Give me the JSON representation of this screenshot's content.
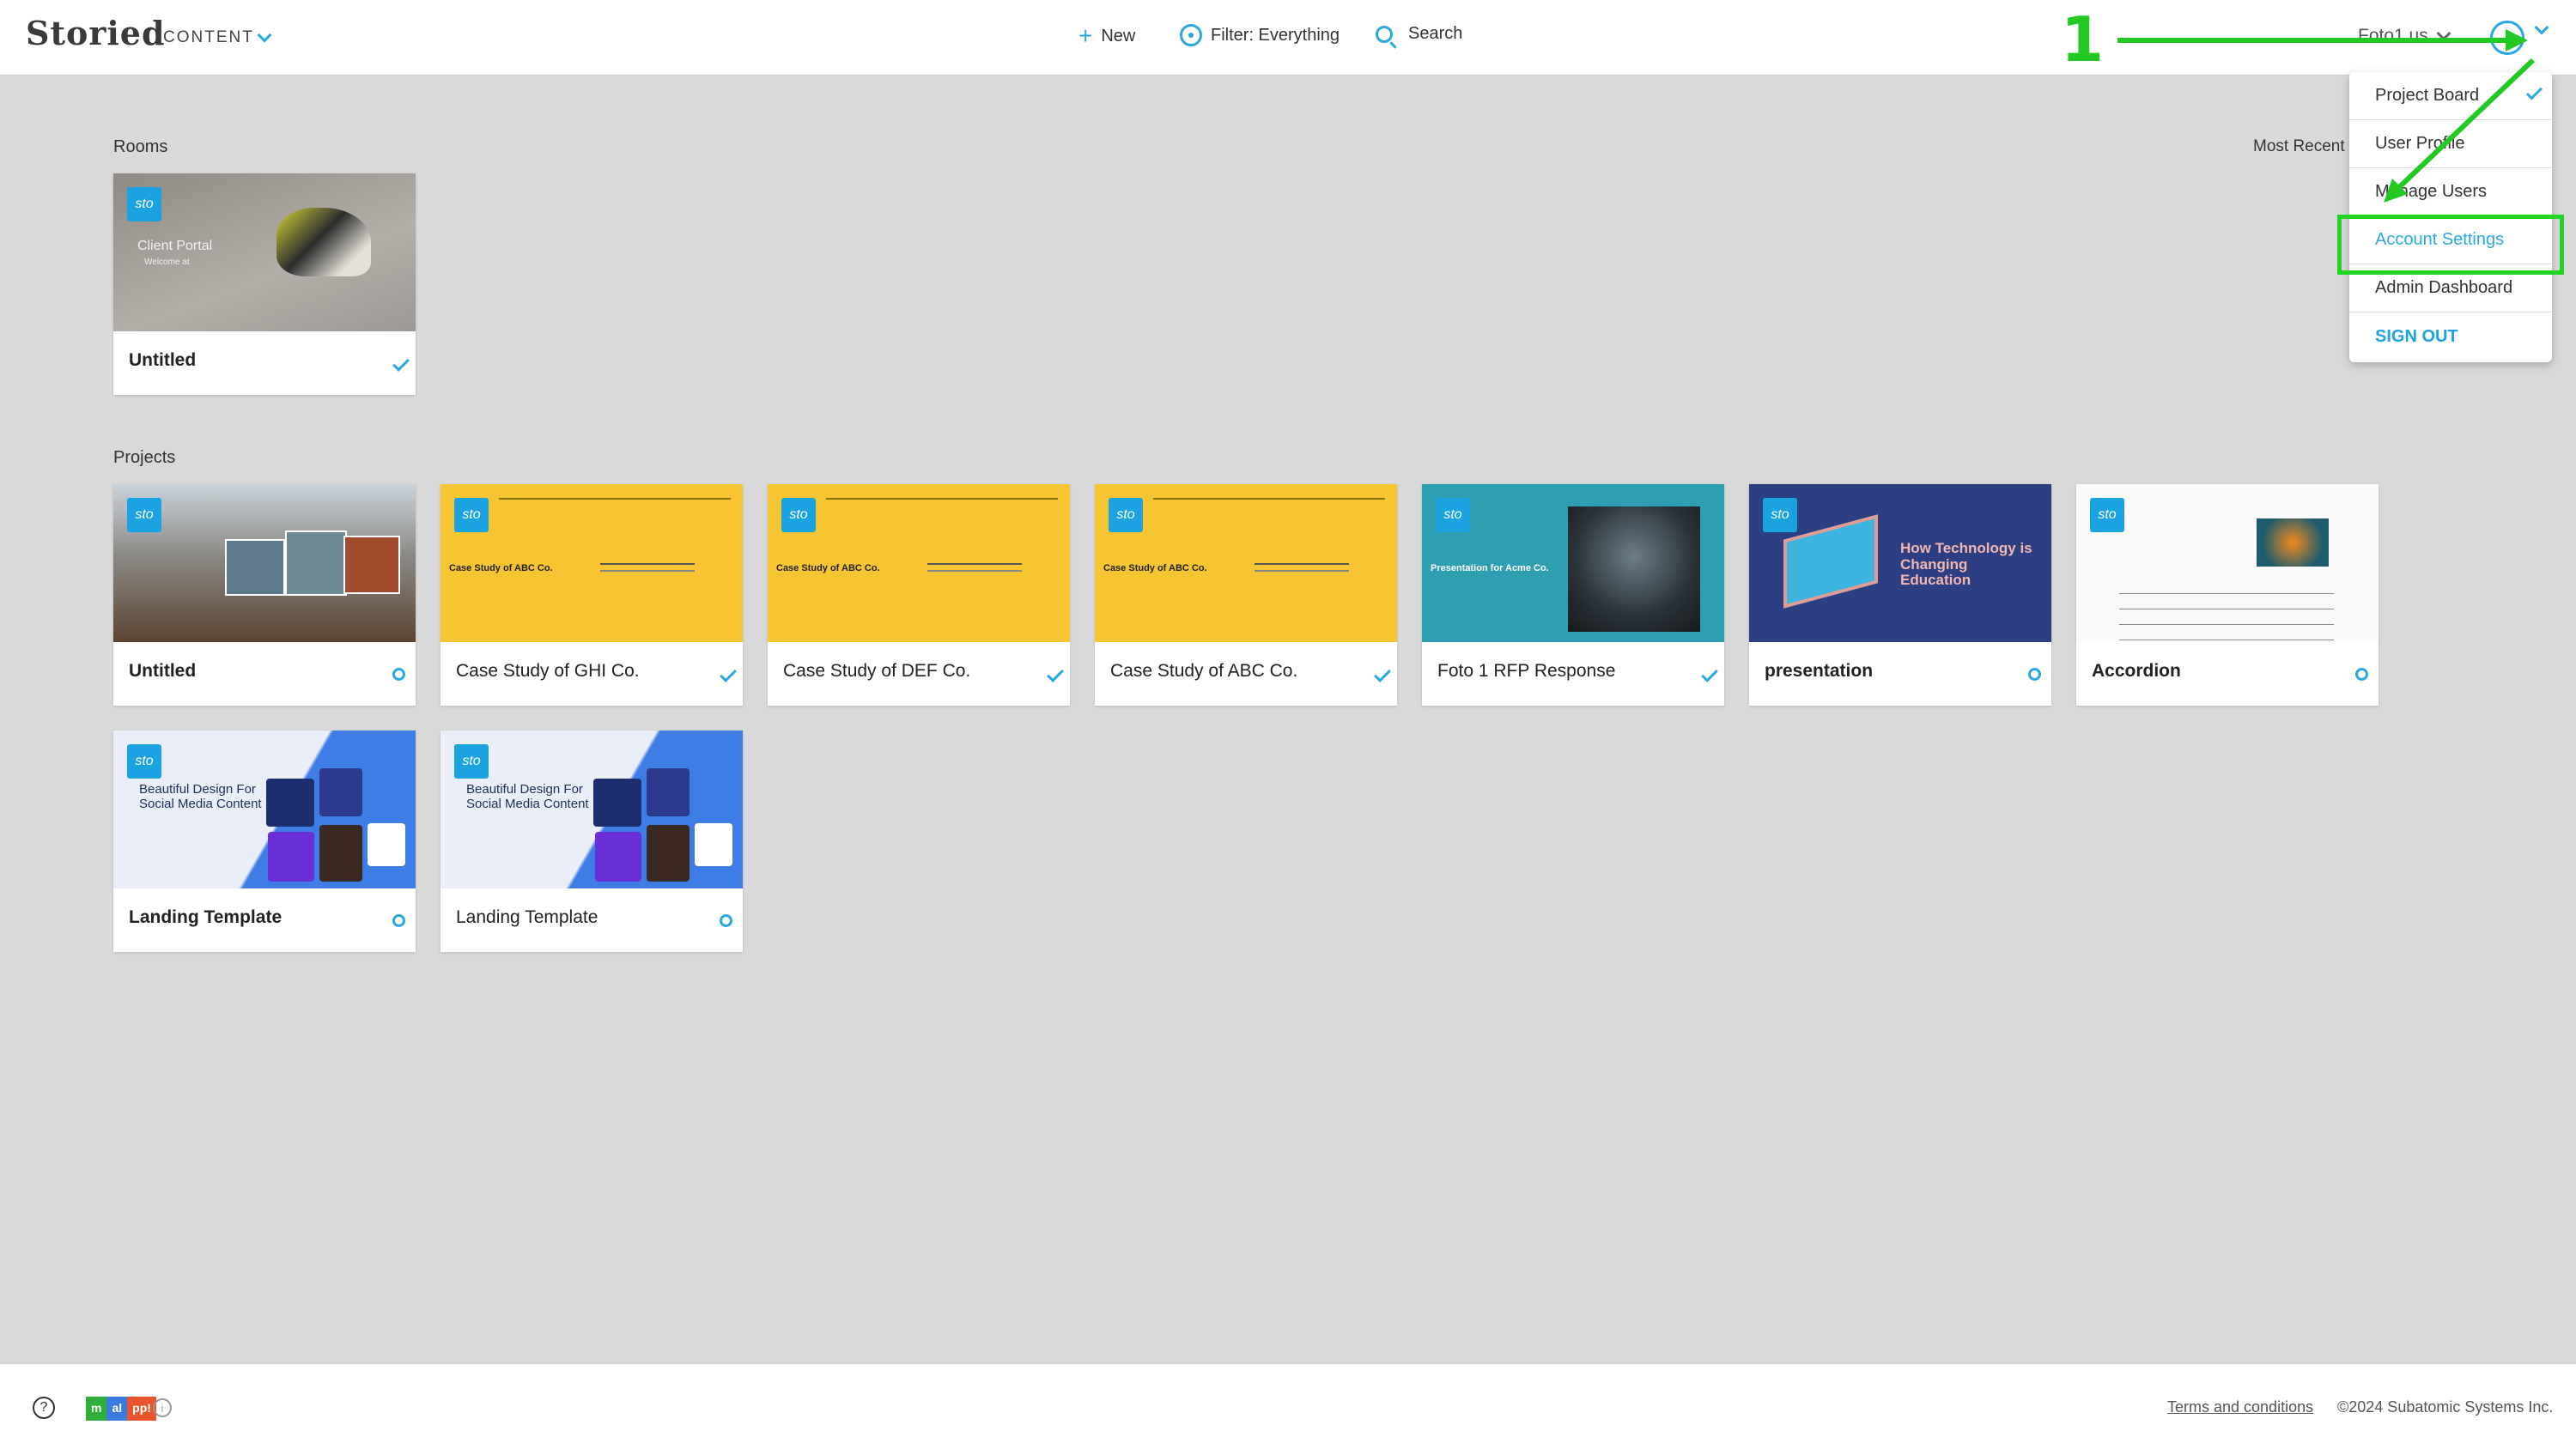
{
  "header": {
    "brand": "Storied",
    "brand_sub": "CONTENT",
    "new_label": "New",
    "filter_label": "Filter: Everything",
    "search_label": "Search",
    "user_label": "Foto1 us"
  },
  "rooms": {
    "title": "Rooms",
    "sort_label": "Most Recent",
    "items": [
      {
        "title": "Untitled",
        "thumb_text": "Client Portal",
        "thumb_sub": "Welcome at",
        "status": "check"
      }
    ]
  },
  "projects": {
    "title": "Projects",
    "items": [
      {
        "title": "Untitled",
        "status": "circle"
      },
      {
        "title": "Case Study of GHI Co.",
        "thumb_text": "Case Study of ABC Co.",
        "status": "check"
      },
      {
        "title": "Case Study of DEF Co.",
        "thumb_text": "Case Study of ABC Co.",
        "status": "check"
      },
      {
        "title": "Case Study of ABC Co.",
        "thumb_text": "Case Study of ABC Co.",
        "status": "check"
      },
      {
        "title": "Foto 1 RFP Response",
        "thumb_text": "Presentation for Acme Co.",
        "status": "check"
      },
      {
        "title": "presentation",
        "thumb_text": "How Technology is Changing Education",
        "status": "circle"
      },
      {
        "title": "Accordion",
        "status": "circle"
      },
      {
        "title": "Landing Template",
        "thumb_text": "Beautiful Design For Social Media Content",
        "status": "circle"
      },
      {
        "title": "Landing Template",
        "thumb_text": "Beautiful Design For Social Media Content",
        "status": "circle"
      }
    ]
  },
  "logo_badge": "sto",
  "dropdown": {
    "items": [
      {
        "label": "Project Board",
        "checked": true
      },
      {
        "label": "User Profile"
      },
      {
        "label": "Manage Users"
      },
      {
        "label": "Account Settings",
        "highlighted": true
      },
      {
        "label": "Admin Dashboard"
      },
      {
        "label": "SIGN OUT"
      }
    ]
  },
  "annotation": {
    "step_number": "1",
    "color": "#22c922"
  },
  "footer": {
    "help": "?",
    "badge_parts": [
      "m",
      "al",
      "pp!"
    ],
    "info": "i",
    "terms": "Terms and conditions",
    "copyright": "©2024 Subatomic Systems Inc."
  },
  "colors": {
    "accent": "#2aa8e0",
    "page_bg": "#d9d9d9",
    "annotation": "#22c922"
  }
}
